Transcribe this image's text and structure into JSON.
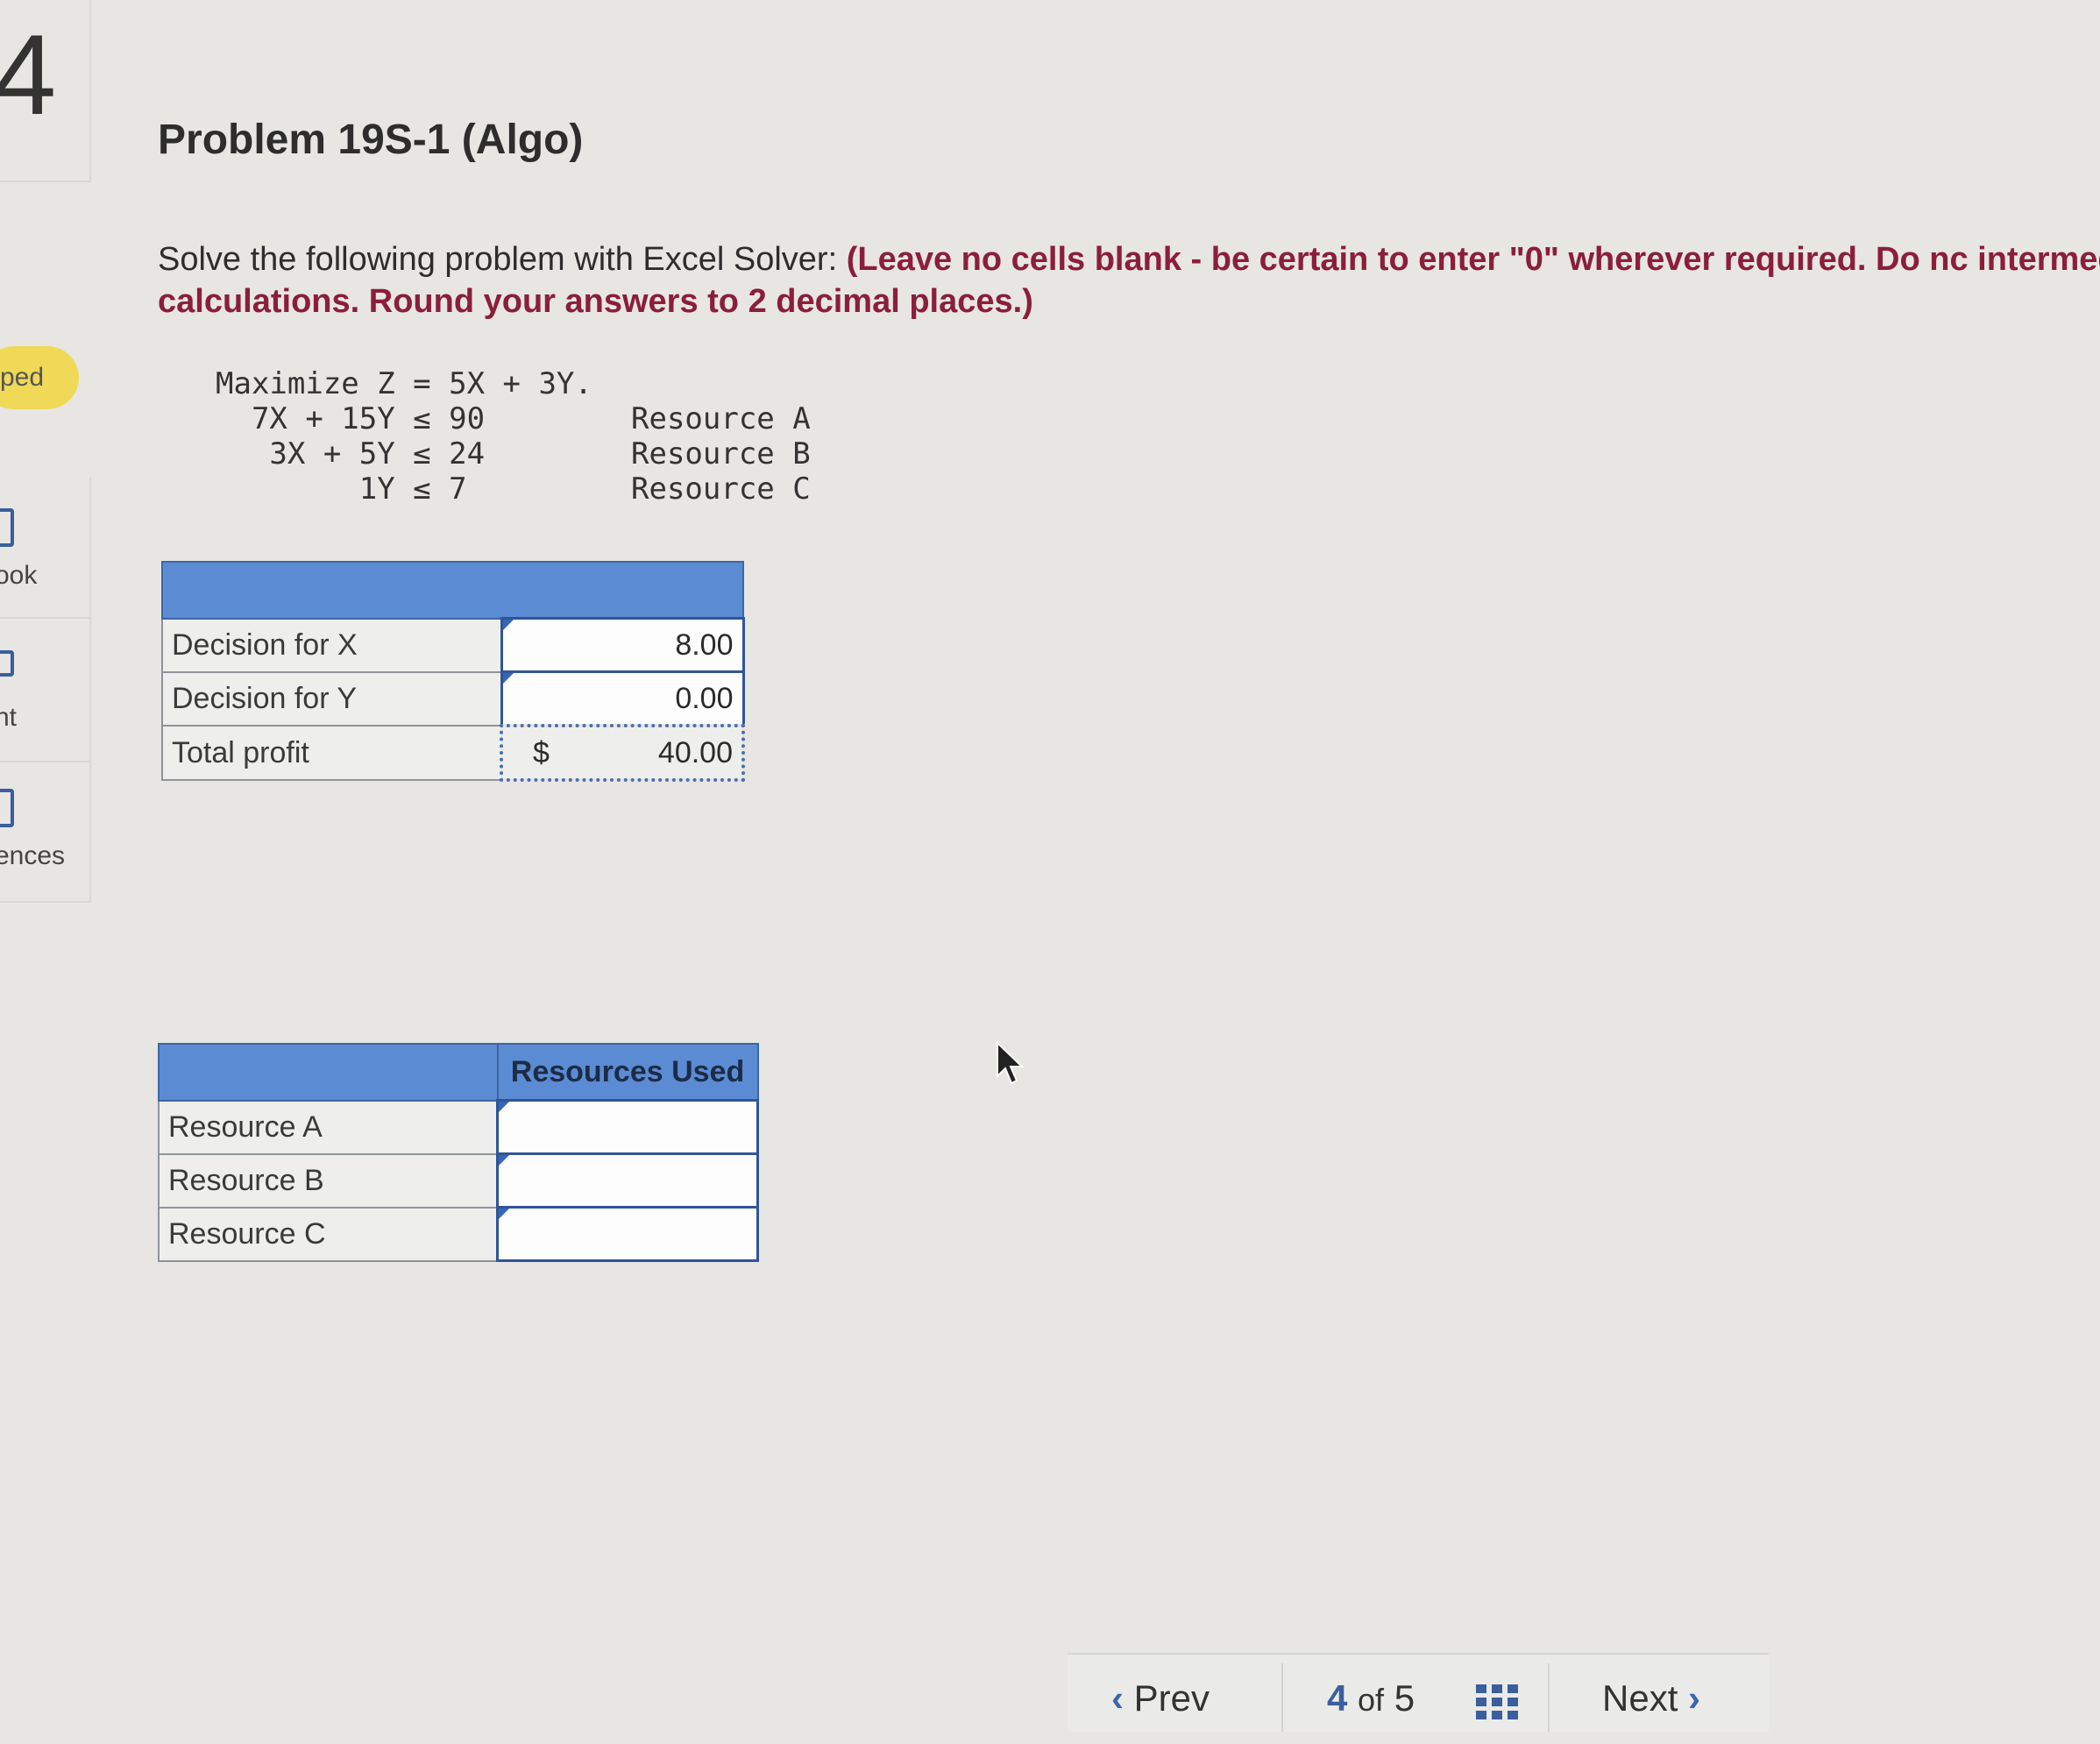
{
  "sidebar": {
    "question_number": "4",
    "status": "ped",
    "items": [
      {
        "label": "ook"
      },
      {
        "label": "nt"
      },
      {
        "label": "ences"
      }
    ]
  },
  "problem": {
    "title": "Problem 19S-1 (Algo)",
    "instruction_plain": "Solve the following problem with Excel Solver: ",
    "instruction_bold": "(Leave no cells blank - be certain to enter \"0\" wherever required. Do nc intermediate calculations. Round your answers to 2 decimal places.)",
    "lp_lines": "Maximize Z = 5X + 3Y.\n  7X + 15Y ≤ 90\n   3X + 5Y ≤ 24\n        1Y ≤ 7",
    "lp_resources": "Resource A\nResource B\nResource C"
  },
  "decision_table": {
    "header": "",
    "rows": [
      {
        "label": "Decision for X",
        "value": "8.00"
      },
      {
        "label": "Decision for Y",
        "value": "0.00"
      },
      {
        "label": "Total profit",
        "currency": "$",
        "value": "40.00"
      }
    ]
  },
  "resources_table": {
    "header_blank": "",
    "header": "Resources Used",
    "rows": [
      {
        "label": "Resource A",
        "value": ""
      },
      {
        "label": "Resource B",
        "value": ""
      },
      {
        "label": "Resource C",
        "value": ""
      }
    ]
  },
  "nav": {
    "prev": "Prev",
    "page_current": "4",
    "page_of": "of",
    "page_total": "5",
    "next": "Next"
  },
  "colors": {
    "header_blue": "#5b8bd3",
    "warning_text": "#8b1e3b",
    "skipped_badge": "#efd957"
  }
}
